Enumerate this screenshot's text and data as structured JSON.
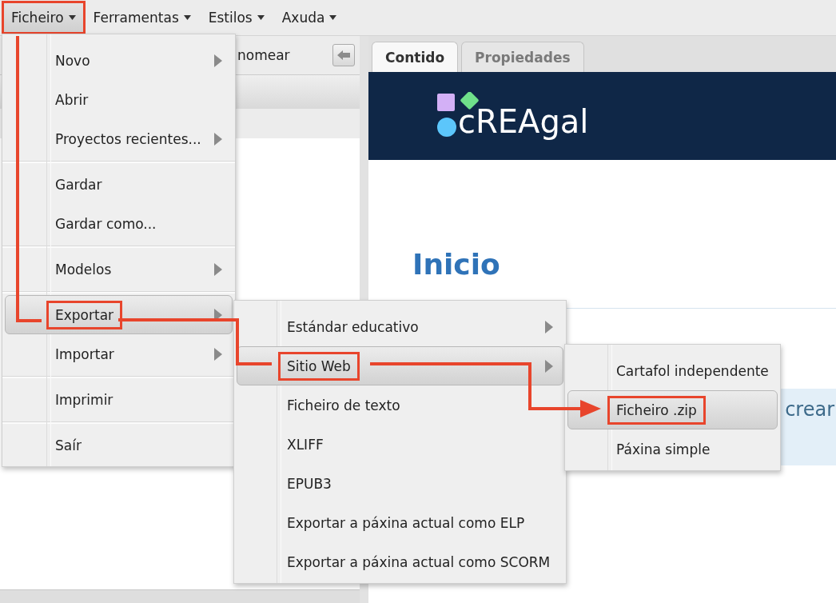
{
  "menubar": [
    {
      "label": "Ficheiro",
      "selected": true,
      "annotated": true
    },
    {
      "label": "Ferramentas",
      "selected": false,
      "annotated": false
    },
    {
      "label": "Estilos",
      "selected": false,
      "annotated": false
    },
    {
      "label": "Axuda",
      "selected": false,
      "annotated": false
    }
  ],
  "left_panel": {
    "toolbar_label": "nomear"
  },
  "right_panel": {
    "tabs": [
      {
        "label": "Contido",
        "selected": true
      },
      {
        "label": "Propiedades",
        "selected": false
      }
    ],
    "logo_text": "cREAgal",
    "heading": "Inicio",
    "box_text": "crear"
  },
  "menus": [
    {
      "items": [
        {
          "kind": "item",
          "label": "Novo",
          "submenu": true,
          "selected": false,
          "annotated": false
        },
        {
          "kind": "item",
          "label": "Abrir",
          "submenu": false,
          "selected": false,
          "annotated": false
        },
        {
          "kind": "item",
          "label": "Proyectos recientes...",
          "submenu": true,
          "selected": false,
          "annotated": false
        },
        {
          "kind": "separator"
        },
        {
          "kind": "item",
          "label": "Gardar",
          "submenu": false,
          "selected": false,
          "annotated": false
        },
        {
          "kind": "item",
          "label": "Gardar como...",
          "submenu": false,
          "selected": false,
          "annotated": false
        },
        {
          "kind": "separator"
        },
        {
          "kind": "item",
          "label": "Modelos",
          "submenu": true,
          "selected": false,
          "annotated": false
        },
        {
          "kind": "separator"
        },
        {
          "kind": "item",
          "label": "Exportar",
          "submenu": true,
          "selected": true,
          "annotated": true
        },
        {
          "kind": "item",
          "label": "Importar",
          "submenu": true,
          "selected": false,
          "annotated": false
        },
        {
          "kind": "separator"
        },
        {
          "kind": "item",
          "label": "Imprimir",
          "submenu": false,
          "selected": false,
          "annotated": false
        },
        {
          "kind": "separator"
        },
        {
          "kind": "item",
          "label": "Saír",
          "submenu": false,
          "selected": false,
          "annotated": false
        }
      ]
    },
    {
      "items": [
        {
          "kind": "item",
          "label": "Estándar educativo",
          "submenu": true,
          "selected": false,
          "annotated": false
        },
        {
          "kind": "item",
          "label": "Sitio Web",
          "submenu": true,
          "selected": true,
          "annotated": true
        },
        {
          "kind": "item",
          "label": "Ficheiro de texto",
          "submenu": false,
          "selected": false,
          "annotated": false
        },
        {
          "kind": "item",
          "label": "XLIFF",
          "submenu": false,
          "selected": false,
          "annotated": false
        },
        {
          "kind": "item",
          "label": "EPUB3",
          "submenu": false,
          "selected": false,
          "annotated": false
        },
        {
          "kind": "item",
          "label": "Exportar a páxina actual como ELP",
          "submenu": false,
          "selected": false,
          "annotated": false
        },
        {
          "kind": "item",
          "label": "Exportar a páxina actual como SCORM",
          "submenu": false,
          "selected": false,
          "annotated": false
        }
      ]
    },
    {
      "items": [
        {
          "kind": "item",
          "label": "Cartafol independente",
          "submenu": false,
          "selected": false,
          "annotated": false
        },
        {
          "kind": "item",
          "label": "Ficheiro .zip",
          "submenu": false,
          "selected": true,
          "annotated": true
        },
        {
          "kind": "item",
          "label": "Páxina simple",
          "submenu": false,
          "selected": false,
          "annotated": false
        }
      ]
    }
  ]
}
